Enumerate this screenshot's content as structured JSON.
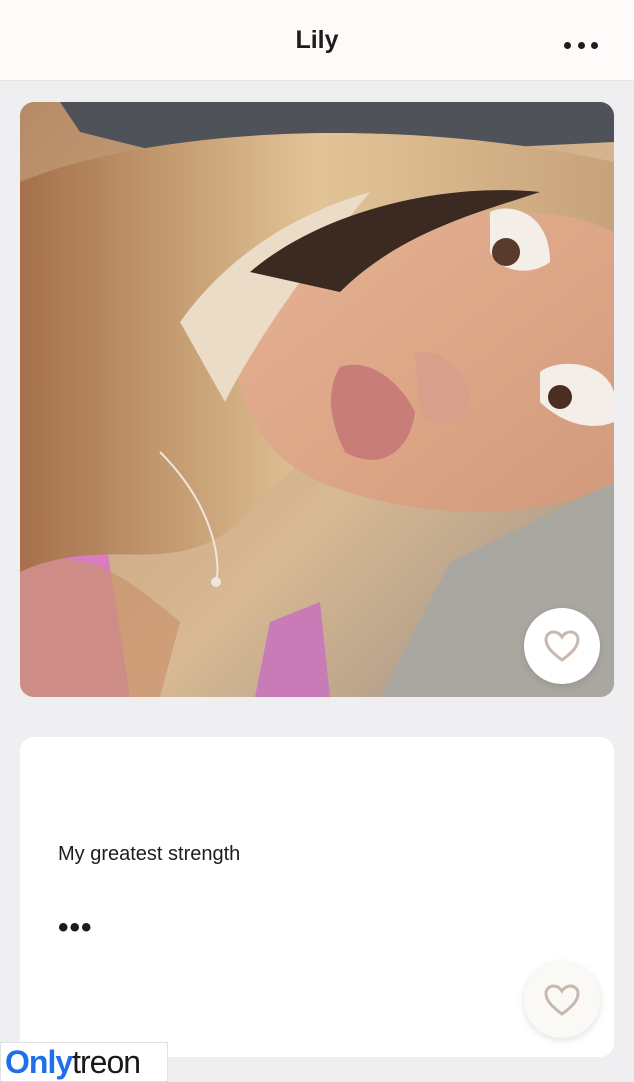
{
  "header": {
    "title": "Lily",
    "more_icon": "ellipsis-horizontal-icon"
  },
  "photo": {
    "description_icon": "profile-photo",
    "like_icon": "heart-outline-icon"
  },
  "prompt": {
    "question": "My greatest strength",
    "answer": "•••",
    "like_icon": "heart-outline-icon"
  },
  "watermark": {
    "part1": "Only",
    "part2": "treon"
  },
  "colors": {
    "background": "#efeff1",
    "card": "#ffffff",
    "text": "#1f1d1c",
    "watermark_blue": "#1f6fe8"
  }
}
